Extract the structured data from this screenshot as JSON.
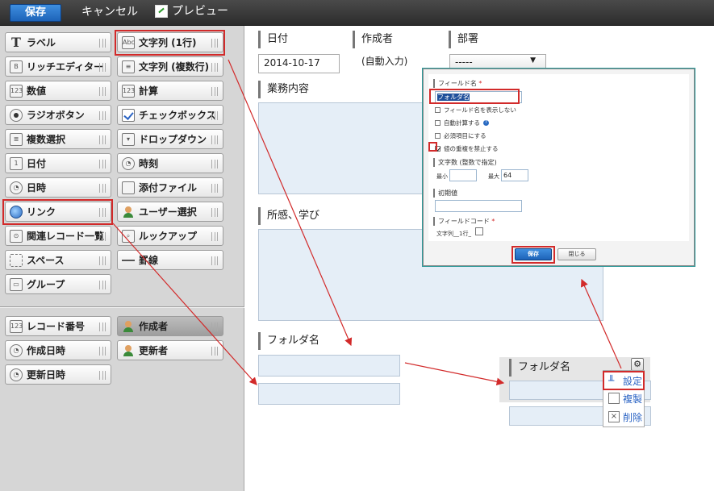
{
  "toolbar": {
    "save_label": "保存",
    "cancel_label": "キャンセル",
    "preview_label": "プレビュー"
  },
  "palette": {
    "items": [
      {
        "label": "ラベル",
        "icon": "label-icon"
      },
      {
        "label": "文字列 (1行)",
        "icon": "single-line-text-icon"
      },
      {
        "label": "リッチエディター",
        "icon": "rich-editor-icon"
      },
      {
        "label": "文字列 (複数行)",
        "icon": "multi-line-text-icon"
      },
      {
        "label": "数値",
        "icon": "number-icon"
      },
      {
        "label": "計算",
        "icon": "calc-icon"
      },
      {
        "label": "ラジオボタン",
        "icon": "radio-icon"
      },
      {
        "label": "チェックボックス",
        "icon": "checkbox-icon"
      },
      {
        "label": "複数選択",
        "icon": "multi-select-icon"
      },
      {
        "label": "ドロップダウン",
        "icon": "dropdown-icon"
      },
      {
        "label": "日付",
        "icon": "calendar-icon"
      },
      {
        "label": "時刻",
        "icon": "clock-icon"
      },
      {
        "label": "日時",
        "icon": "clock-icon"
      },
      {
        "label": "添付ファイル",
        "icon": "attachment-icon"
      },
      {
        "label": "リンク",
        "icon": "globe-icon"
      },
      {
        "label": "ユーザー選択",
        "icon": "user-icon"
      },
      {
        "label": "関連レコード一覧",
        "icon": "related-records-icon"
      },
      {
        "label": "ルックアップ",
        "icon": "lookup-icon"
      },
      {
        "label": "スペース",
        "icon": "space-icon"
      },
      {
        "label": "罫線",
        "icon": "line-icon"
      },
      {
        "label": "グループ",
        "icon": "group-icon"
      }
    ],
    "system_items": [
      {
        "label": "レコード番号",
        "icon": "record-number-icon"
      },
      {
        "label": "作成者",
        "icon": "user-icon"
      },
      {
        "label": "作成日時",
        "icon": "clock-icon"
      },
      {
        "label": "更新者",
        "icon": "user-icon"
      },
      {
        "label": "更新日時",
        "icon": "clock-icon"
      }
    ],
    "icon_text": {
      "number": "123",
      "text": "Abc"
    }
  },
  "form": {
    "date_label": "日付",
    "date_value": "2014-10-17",
    "creator_label": "作成者",
    "creator_value": "(自動入力)",
    "dept_label": "部署",
    "dept_value": "-----",
    "task_label": "業務内容",
    "impressions_label": "所感、学び",
    "folder_label": "フォルダ名",
    "folder_label_copy": "フォルダ名"
  },
  "dialog": {
    "field_name_label": "フィールド名",
    "field_name_value": "フォルダ名",
    "required_mark": "*",
    "opt_hide_name": "フィールド名を表示しない",
    "opt_auto_calc": "自動計算する",
    "opt_required": "必須項目にする",
    "opt_unique": "値の重複を禁止する",
    "length_label": "文字数 (整数で指定)",
    "min_label": "最小",
    "max_label": "最大",
    "max_value": "64",
    "default_label": "初期値",
    "field_code_label": "フィールドコード",
    "field_code_value": "文字列__1行_",
    "save_label": "保存",
    "close_label": "閉じる"
  },
  "gear_menu": {
    "settings": "設定",
    "duplicate": "複製",
    "delete": "削除"
  },
  "colors": {
    "accent_blue": "#1d63b8",
    "highlight_red": "#d22a2a",
    "field_bg": "#e5eef7"
  }
}
